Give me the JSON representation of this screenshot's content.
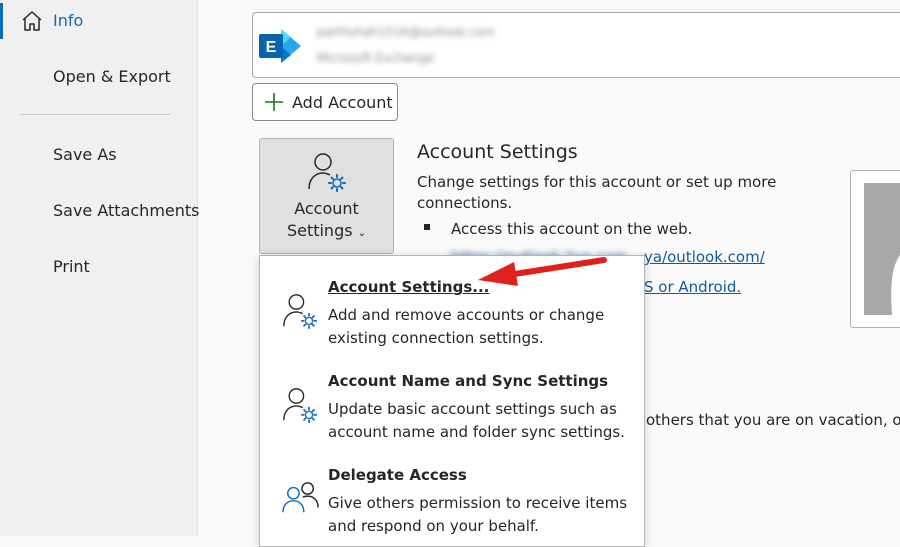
{
  "sidebar": {
    "items": [
      {
        "label": "Info",
        "icon": "home-icon",
        "selected": true
      },
      {
        "label": "Open & Export"
      },
      {
        "label": "Save As"
      },
      {
        "label": "Save Attachments"
      },
      {
        "label": "Print"
      }
    ]
  },
  "account": {
    "email": "parthshah1516@outlook.com",
    "type": "Microsoft Exchange"
  },
  "add_account": {
    "label": "Add Account"
  },
  "account_settings_button": {
    "line1": "Account",
    "line2": "Settings"
  },
  "section": {
    "title": "Account Settings",
    "description": "Change settings for this account or set up more connections.",
    "bullet": "Access this account on the web.",
    "link1_visible": "ya/outlook.com/",
    "link1_blurred": "https://outlook.live.com/owa/outl",
    "link2_visible": "S or Android.",
    "partial_text": "others that you are on vacation, or"
  },
  "dropdown": {
    "items": [
      {
        "title": "Account Settings...",
        "desc": "Add and remove accounts or change existing connection settings.",
        "icon": "account-settings-icon"
      },
      {
        "title": "Account Name and Sync Settings",
        "desc": "Update basic account settings such as account name and folder sync settings.",
        "icon": "account-name-sync-icon"
      },
      {
        "title": "Delegate Access",
        "desc": "Give others permission to receive items and respond on your behalf.",
        "icon": "delegate-access-icon"
      }
    ]
  },
  "colors": {
    "accent": "#0f6cbd",
    "arrow": "#e0201b",
    "plus": "#107c10"
  }
}
